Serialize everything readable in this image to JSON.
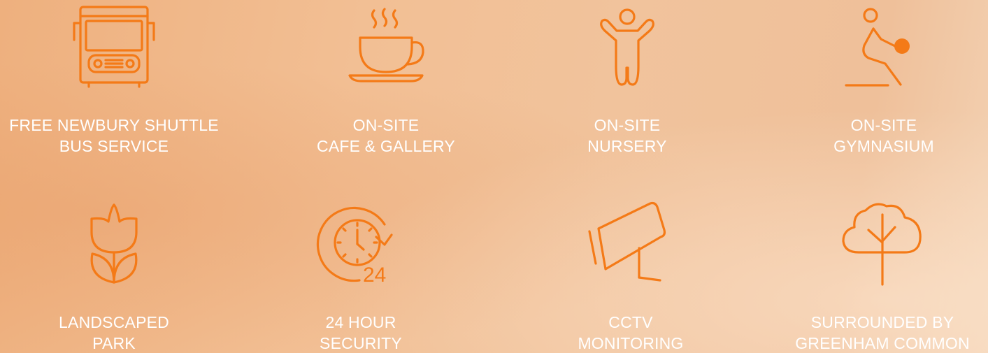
{
  "accent_color": "#f47a17",
  "label_color": "#ffffff",
  "features": [
    {
      "icon": "bus-icon",
      "line1": "FREE NEWBURY SHUTTLE",
      "line2": "BUS SERVICE"
    },
    {
      "icon": "coffee-cup-icon",
      "line1": "ON-SITE",
      "line2": "CAFE & GALLERY"
    },
    {
      "icon": "child-icon",
      "line1": "ON-SITE",
      "line2": "NURSERY"
    },
    {
      "icon": "gym-ball-icon",
      "line1": "ON-SITE",
      "line2": "GYMNASIUM"
    },
    {
      "icon": "tulip-icon",
      "line1": "LANDSCAPED",
      "line2": "PARK"
    },
    {
      "icon": "clock-24-icon",
      "line1": "24 HOUR",
      "line2": "SECURITY",
      "icon_text": "24"
    },
    {
      "icon": "cctv-camera-icon",
      "line1": "CCTV",
      "line2": "MONITORING"
    },
    {
      "icon": "tree-icon",
      "line1": "SURROUNDED BY",
      "line2": "GREENHAM COMMON"
    }
  ]
}
